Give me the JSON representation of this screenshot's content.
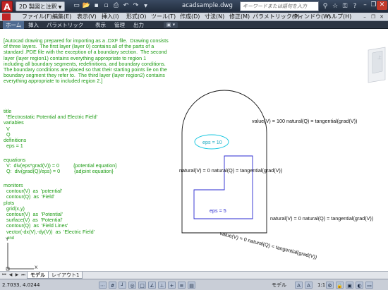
{
  "title_bar": {
    "app_logo": "A",
    "workspace": "2D 製図と注釈",
    "file_name": "acadsample.dwg",
    "search_placeholder": "キーワードまたは語句を入力",
    "quick_access_icons": [
      "new-icon",
      "open-icon",
      "save-icon",
      "saveas-icon",
      "print-icon",
      "undo-icon",
      "redo-icon",
      "dropdown-icon"
    ],
    "right_icons": [
      "binoculars-icon",
      "star-icon",
      "key-icon",
      "help-icon"
    ],
    "window_buttons": {
      "minimize": "–",
      "restore": "❐",
      "close": "✕"
    }
  },
  "menu_bar": {
    "items": [
      "ファイル(F)",
      "編集(E)",
      "表示(V)",
      "挿入(I)",
      "形式(O)",
      "ツール(T)",
      "作成(D)",
      "寸法(N)",
      "修正(M)",
      "パラメトリック(P)",
      "ウィンドウ(W)",
      "ヘルプ(H)"
    ],
    "window_buttons": [
      "–",
      "❐",
      "✕"
    ]
  },
  "ribbon_tabs": {
    "tabs": [
      "ホーム",
      "挿入",
      "パラメトリック",
      "表示",
      "管理",
      "出力"
    ],
    "active": "ホーム",
    "options_label": "▣ ▾"
  },
  "drawing": {
    "intro_lines": [
      "[Autocad drawing prepared for importing as a .DXF file.  Drawing consists",
      "of three layers.  The first layer (layer 0) contains all of the parts of a",
      "standard .PDE file with the exception of a boundary section.  The second",
      "layer (layer region1) contains everything appropriate to region 1",
      "including all boundary segments, redefinitions, and boundary conditions.",
      "The boundary conditions are placed so that their starting points lie on the",
      "boundary segment they refer to.  The third layer (layer region2) contains",
      "everything appropriate to included region 2.]"
    ],
    "title_lines": [
      "title",
      "  'Electrostatic Potential and Electric Field'",
      "variables",
      "  V",
      "  Q",
      "definitions",
      "  eps = 1"
    ],
    "equation_lines": [
      "equations",
      "  V:  div(eps*grad(V)) = 0          {potential equation}",
      "  Q:  div(grad(Q)/eps) = 0          {adjoint equation}"
    ],
    "monitor_lines": [
      "monitors",
      "  contour(V)  as  'potential'",
      "  contour(Q)  as  'Field'",
      "plots",
      "  grid(x,y)",
      "  contour(V)  as  'Potential'",
      "  surface(V)  as  'Potential'",
      "  contour(Q)  as  'Field Lines'",
      "  vector(-dx(V),-dy(V))  as  'Electric Field'"
    ],
    "bc_top": "value(V) = 100 natural(Q) = tangential(grad(V))",
    "bc_left": "natural(V) = 0 natural(Q) = tangential(grad(V))",
    "bc_right": "natural(V) = 0 natural(Q) = tangential(grad(V))",
    "bc_bottom": "value(V) = 0 natural(Q) = tangential(grad(V))",
    "eps_outer": "eps = 10",
    "eps_inner": "eps = 5",
    "ucs_y": "Y",
    "ucs_x": "X",
    "ucs_z": "end",
    "viewcube_label": "上"
  },
  "layout_tabs": {
    "tabs": [
      "モデル",
      "レイアウト1"
    ],
    "active": "モデル"
  },
  "status_bar": {
    "coordinates": "2.7033, 4.0244",
    "model_label": "モデル",
    "scale_label": "1:1",
    "mode_icons": [
      "snap-icon",
      "grid-icon",
      "ortho-icon",
      "polar-icon",
      "osnap-icon",
      "otrack-icon",
      "ducs-icon",
      "dyn-icon",
      "lwt-icon",
      "qp-icon"
    ],
    "right_icons": [
      "annotation-icon",
      "autoscale-icon",
      "workspace-icon",
      "lock-icon",
      "hardware-icon",
      "isolate-icon",
      "cleanscreen-icon"
    ]
  },
  "colors": {
    "titlebar": "#2b3648",
    "green_text": "#1d9c14",
    "blue_region": "#2a2ad0",
    "cyan_ellipse": "#19c7e0",
    "black_outline": "#111111"
  }
}
